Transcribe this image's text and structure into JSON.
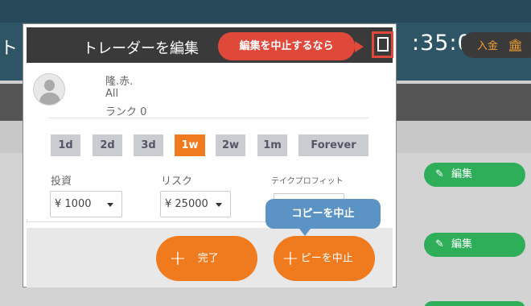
{
  "background": {
    "left_char": "ト",
    "clock": ":35:05",
    "deposit_label": "入金",
    "bank_icon": "bank-icon",
    "edit_buttons": [
      "編集",
      "編集"
    ]
  },
  "modal": {
    "title": "トレーダーを編集",
    "close_icon": "copy-icon"
  },
  "callouts": {
    "close_hint": "編集を中止するなら",
    "stop_hint": "コピーを中止"
  },
  "trader": {
    "name": "隆.赤.",
    "group": "All",
    "rank": "ランク 0"
  },
  "periods": [
    {
      "label": "1d",
      "active": false
    },
    {
      "label": "2d",
      "active": false
    },
    {
      "label": "3d",
      "active": false
    },
    {
      "label": "1w",
      "active": true
    },
    {
      "label": "2w",
      "active": false
    },
    {
      "label": "1m",
      "active": false
    },
    {
      "label": "Forever",
      "active": false
    }
  ],
  "fields": {
    "investment_label": "投資",
    "investment_value": "¥ 1000",
    "risk_label": "リスク",
    "risk_value": "¥ 25000",
    "take_profit_label": "テイクプロフィット"
  },
  "footer": {
    "done_label": "完了",
    "stop_label": "ピーを中止"
  },
  "colors": {
    "accent_orange": "#f07a1e",
    "callout_red": "#e0483a",
    "callout_blue": "#5b93c4",
    "edit_green": "#2fae5a"
  }
}
